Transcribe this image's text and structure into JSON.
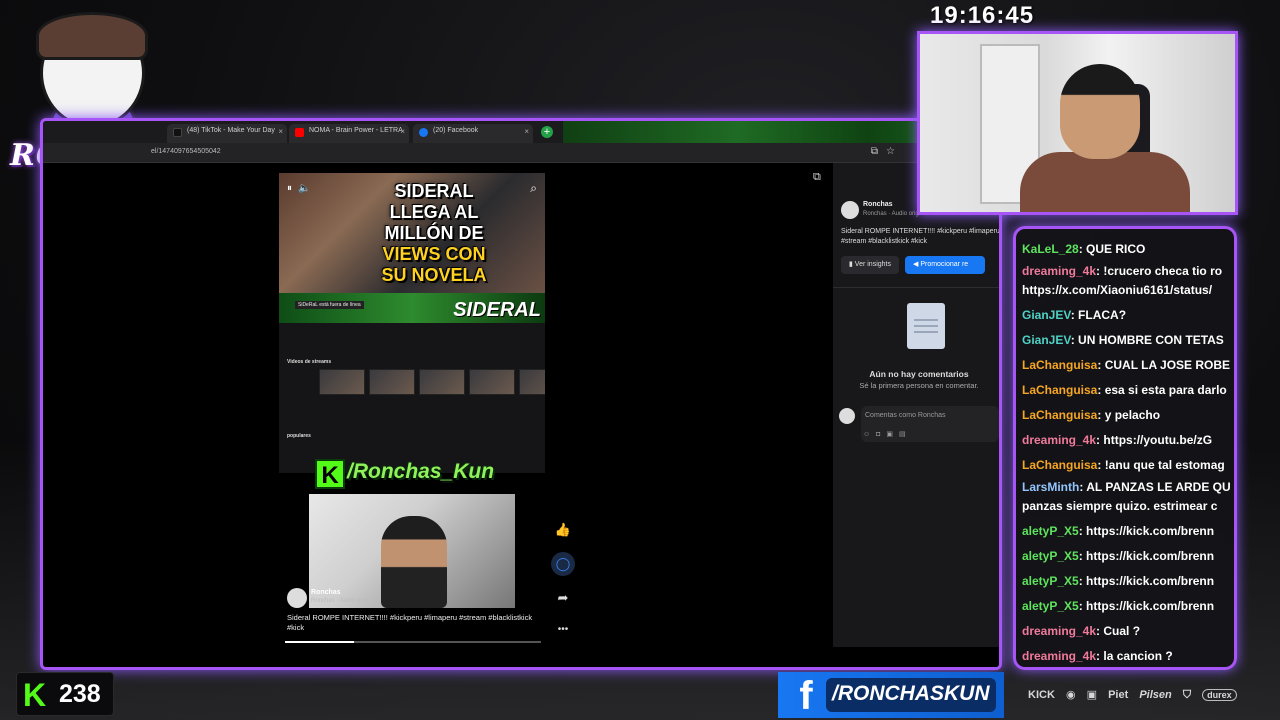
{
  "clock": "19:16:45",
  "logo": {
    "text": "RONCHAS",
    "fb_glyph": "f"
  },
  "browser": {
    "tabs": [
      {
        "label": "(48) TikTok - Make Your Day",
        "color": "#111111"
      },
      {
        "label": "NOMA - Brain Power - LETRA",
        "color": "#ff0000"
      },
      {
        "label": "(20) Facebook",
        "color": "#1877f2"
      }
    ],
    "address": "el/1474097654505042"
  },
  "reel": {
    "headline": [
      "SIDERAL",
      "LLEGA AL",
      "MILLÓN DE",
      "VIEWS CON",
      "SU NOVELA"
    ],
    "banner_text": "SIDERAL",
    "offline_text": "SiDeRaL está fuera de línea",
    "section_streams": "Videos de streams",
    "section_popular": "populares",
    "kick_overlay": "/Ronchas_Kun",
    "author": "Ronchas",
    "audio": "Ronchas · Audio original",
    "caption": "Sideral ROMPE INTERNET!!!! #kickperu #limaperu #stream #blacklistkick #kick",
    "progress": 0.27
  },
  "comments_panel": {
    "author": "Ronchas",
    "audio": "Ronchas · Audio original",
    "caption": "Sideral ROMPE INTERNET!!!! #kickperu #limaperu #stream #blacklistkick #kick",
    "insights_label": "Ver insights",
    "promote_label": "Promocionar re",
    "empty_title": "Aún no hay comentarios",
    "empty_subtitle": "Sé la primera persona en comentar.",
    "input_placeholder": "Comentas como Ronchas"
  },
  "chat": [
    {
      "user": "KaLeL_28",
      "color": "#5ee35e",
      "text": ": QUE RICO"
    },
    {
      "user": "dreaming_4k",
      "color": "#f07a9c",
      "text": ": !crucero checa tio ro https://x.com/Xiaoniu6161/status/",
      "wrap": true
    },
    {
      "user": "GianJEV",
      "color": "#4fd1c5",
      "text": ": FLACA?"
    },
    {
      "user": "GianJEV",
      "color": "#4fd1c5",
      "text": ": UN HOMBRE CON TETAS"
    },
    {
      "user": "LaChanguisa",
      "color": "#f6a623",
      "text": ": CUAL LA JOSE ROBE"
    },
    {
      "user": "LaChanguisa",
      "color": "#f6a623",
      "text": ": esa si esta para darlo"
    },
    {
      "user": "LaChanguisa",
      "color": "#f6a623",
      "text": ": y pelacho"
    },
    {
      "user": "dreaming_4k",
      "color": "#f07a9c",
      "text": ": https://youtu.be/zG"
    },
    {
      "user": "LaChanguisa",
      "color": "#f6a623",
      "text": ": !anu que tal estomag"
    },
    {
      "user": "LarsMinth",
      "color": "#93c5fd",
      "text": ": AL PANZAS LE ARDE QU panzas siempre quizo. estrimear c",
      "wrap": true
    },
    {
      "user": "aletyP_X5",
      "color": "#5ee35e",
      "text": ": https://kick.com/brenn"
    },
    {
      "user": "aletyP_X5",
      "color": "#5ee35e",
      "text": ": https://kick.com/brenn"
    },
    {
      "user": "aletyP_X5",
      "color": "#5ee35e",
      "text": ": https://kick.com/brenn"
    },
    {
      "user": "aletyP_X5",
      "color": "#5ee35e",
      "text": ": https://kick.com/brenn"
    },
    {
      "user": "dreaming_4k",
      "color": "#f07a9c",
      "text": ": Cual ?"
    },
    {
      "user": "dreaming_4k",
      "color": "#f07a9c",
      "text": ": la cancion ?"
    }
  ],
  "kick_counter": {
    "glyph": "K",
    "count": "238"
  },
  "facebook_bar": {
    "glyph": "f",
    "handle": "/RONCHASKUN"
  },
  "sponsors": [
    "KICK",
    "Piet",
    "Pilsen",
    "durex"
  ]
}
